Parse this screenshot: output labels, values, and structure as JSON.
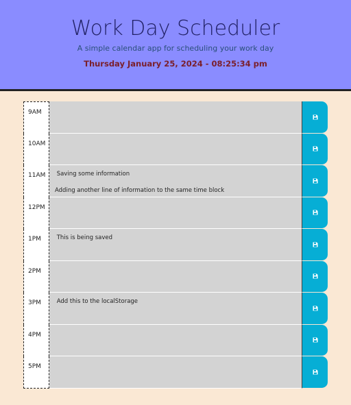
{
  "header": {
    "title": "Work Day Scheduler",
    "subtitle": "A simple calendar app for scheduling your work day",
    "current_day": "Thursday January 25, 2024 - 08:25:34 pm"
  },
  "colors": {
    "jumbotron": "#8a8cff",
    "background": "#fae8d4",
    "past": "#d3d3d3",
    "save_button": "#06aed5"
  },
  "time_blocks": [
    {
      "hour": "9AM",
      "text": "",
      "save_icon": "floppy-disk-icon"
    },
    {
      "hour": "10AM",
      "text": "",
      "save_icon": "floppy-disk-icon"
    },
    {
      "hour": "11AM",
      "text": " Saving some information\n\nAdding another line of information to the same time block",
      "save_icon": "floppy-disk-icon"
    },
    {
      "hour": "12PM",
      "text": "",
      "save_icon": "floppy-disk-icon"
    },
    {
      "hour": "1PM",
      "text": " This is being saved",
      "save_icon": "floppy-disk-icon"
    },
    {
      "hour": "2PM",
      "text": "",
      "save_icon": "floppy-disk-icon"
    },
    {
      "hour": "3PM",
      "text": " Add this to the localStorage",
      "save_icon": "floppy-disk-icon"
    },
    {
      "hour": "4PM",
      "text": "",
      "save_icon": "floppy-disk-icon"
    },
    {
      "hour": "5PM",
      "text": "",
      "save_icon": "floppy-disk-icon"
    }
  ]
}
